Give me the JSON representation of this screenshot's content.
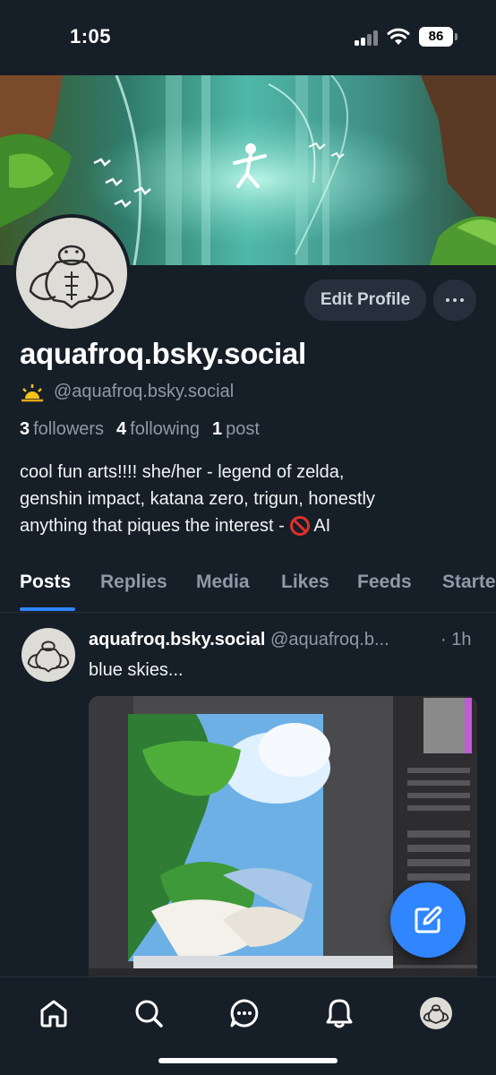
{
  "status_bar": {
    "time": "1:05",
    "battery": "86"
  },
  "profile": {
    "display_name": "aquafroq.bsky.social",
    "handle": "@aquafroq.bsky.social",
    "edit_profile_label": "Edit Profile",
    "followers_count": "3",
    "followers_label": "followers",
    "following_count": "4",
    "following_label": "following",
    "posts_count": "1",
    "posts_label": "post",
    "bio_line1": "cool fun arts!!!! she/her - legend of zelda,",
    "bio_line2": "genshin impact, katana zero, trigun, honestly",
    "bio_line3": "anything that piques the interest - ",
    "bio_line3_end": "AI"
  },
  "tabs": [
    {
      "label": "Posts",
      "active": true
    },
    {
      "label": "Replies"
    },
    {
      "label": "Media"
    },
    {
      "label": "Likes"
    },
    {
      "label": "Feeds"
    },
    {
      "label": "Starte"
    }
  ],
  "post": {
    "author_name": "aquafroq.bsky.social",
    "author_handle": "@aquafroq.b...",
    "time": "· 1h",
    "text": "blue skies..."
  },
  "nav": [
    "home-icon",
    "search-icon",
    "chat-icon",
    "bell-icon",
    "profile-avatar"
  ],
  "colors": {
    "background": "#161e27",
    "accent": "#2f86ff",
    "muted": "#8e9aa8",
    "button_bg": "#26303c"
  }
}
